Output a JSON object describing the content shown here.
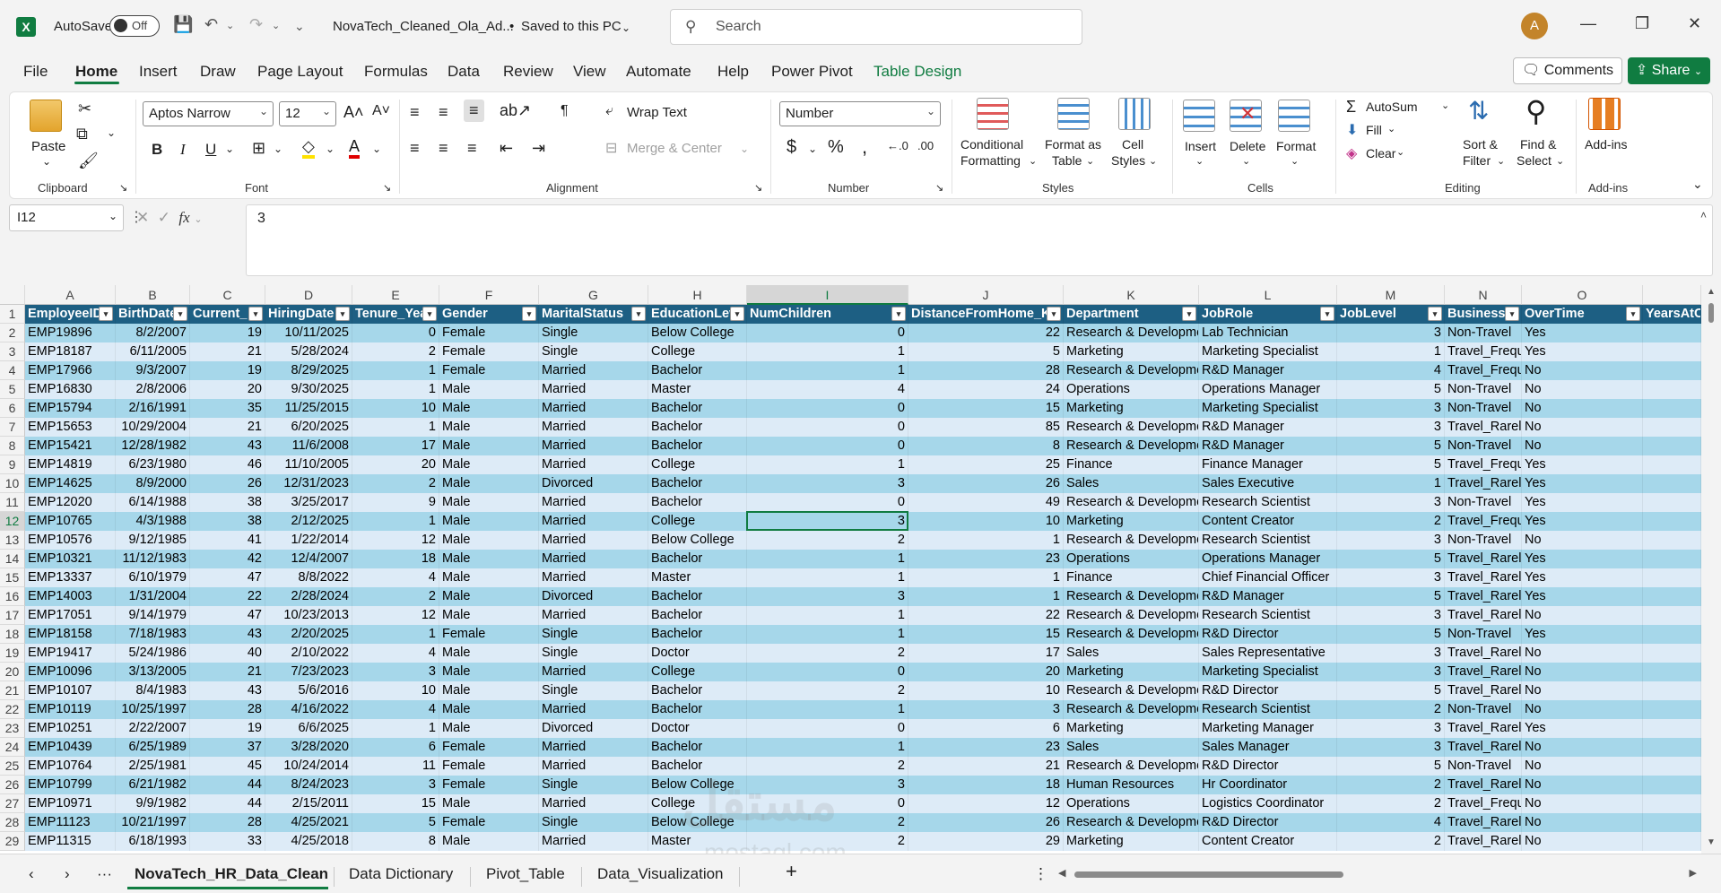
{
  "titlebar": {
    "autosave_label": "AutoSave",
    "autosave_state": "Off",
    "filename": "NovaTech_Cleaned_Ola_Ad...",
    "save_status": "Saved to this PC",
    "search_placeholder": "Search",
    "user_initial": "A"
  },
  "menu": {
    "file": "File",
    "home": "Home",
    "insert": "Insert",
    "draw": "Draw",
    "page_layout": "Page Layout",
    "formulas": "Formulas",
    "data": "Data",
    "review": "Review",
    "view": "View",
    "automate": "Automate",
    "help": "Help",
    "power_pivot": "Power Pivot",
    "table_design": "Table Design",
    "comments": "Comments",
    "share": "Share"
  },
  "ribbon": {
    "clipboard": {
      "paste": "Paste",
      "label": "Clipboard"
    },
    "font": {
      "name": "Aptos Narrow",
      "size": "12",
      "label": "Font"
    },
    "alignment": {
      "wrap": "Wrap Text",
      "merge": "Merge & Center",
      "label": "Alignment"
    },
    "number": {
      "format": "Number",
      "label": "Number"
    },
    "styles": {
      "conditional_1": "Conditional",
      "conditional_2": "Formatting",
      "format_table_1": "Format as",
      "format_table_2": "Table",
      "cell_styles_1": "Cell",
      "cell_styles_2": "Styles",
      "label": "Styles"
    },
    "cells": {
      "insert": "Insert",
      "delete": "Delete",
      "format": "Format",
      "label": "Cells"
    },
    "editing": {
      "autosum": "AutoSum",
      "fill": "Fill",
      "clear": "Clear",
      "sort_1": "Sort &",
      "sort_2": "Filter",
      "find_1": "Find &",
      "find_2": "Select",
      "label": "Editing"
    },
    "addins": {
      "addins": "Add-ins",
      "label": "Add-ins"
    }
  },
  "formula_bar": {
    "name_box": "I12",
    "formula": "3"
  },
  "columns": [
    "A",
    "B",
    "C",
    "D",
    "E",
    "F",
    "G",
    "H",
    "I",
    "J",
    "K",
    "L",
    "M",
    "N",
    "O"
  ],
  "headers": [
    "EmployeeID",
    "BirthDate",
    "Current_",
    "HiringDate",
    "Tenure_Yea",
    "Gender",
    "MaritalStatus",
    "EducationLev",
    "NumChildren",
    "DistanceFromHome_Kl",
    "Department",
    "JobRole",
    "JobLevel",
    "Business",
    "OverTime",
    "YearsAtC"
  ],
  "rows": [
    [
      "EMP19896",
      "8/2/2007",
      "19",
      "10/11/2025",
      "0",
      "Female",
      "Single",
      "Below College",
      "0",
      "22",
      "Research & Developme",
      "Lab Technician",
      "3",
      "Non-Travel",
      "Yes"
    ],
    [
      "EMP18187",
      "6/11/2005",
      "21",
      "5/28/2024",
      "2",
      "Female",
      "Single",
      "College",
      "1",
      "5",
      "Marketing",
      "Marketing Specialist",
      "1",
      "Travel_Frequ",
      "Yes"
    ],
    [
      "EMP17966",
      "9/3/2007",
      "19",
      "8/29/2025",
      "1",
      "Female",
      "Married",
      "Bachelor",
      "1",
      "28",
      "Research & Developme",
      "R&D Manager",
      "4",
      "Travel_Frequ",
      "No"
    ],
    [
      "EMP16830",
      "2/8/2006",
      "20",
      "9/30/2025",
      "1",
      "Male",
      "Married",
      "Master",
      "4",
      "24",
      "Operations",
      "Operations Manager",
      "5",
      "Non-Travel",
      "No"
    ],
    [
      "EMP15794",
      "2/16/1991",
      "35",
      "11/25/2015",
      "10",
      "Male",
      "Married",
      "Bachelor",
      "0",
      "15",
      "Marketing",
      "Marketing Specialist",
      "3",
      "Non-Travel",
      "No"
    ],
    [
      "EMP15653",
      "10/29/2004",
      "21",
      "6/20/2025",
      "1",
      "Male",
      "Married",
      "Bachelor",
      "0",
      "85",
      "Research & Developme",
      "R&D Manager",
      "3",
      "Travel_Rarel",
      "No"
    ],
    [
      "EMP15421",
      "12/28/1982",
      "43",
      "11/6/2008",
      "17",
      "Male",
      "Married",
      "Bachelor",
      "0",
      "8",
      "Research & Developme",
      "R&D Manager",
      "5",
      "Non-Travel",
      "No"
    ],
    [
      "EMP14819",
      "6/23/1980",
      "46",
      "11/10/2005",
      "20",
      "Male",
      "Married",
      "College",
      "1",
      "25",
      "Finance",
      "Finance Manager",
      "5",
      "Travel_Frequ",
      "Yes"
    ],
    [
      "EMP14625",
      "8/9/2000",
      "26",
      "12/31/2023",
      "2",
      "Male",
      "Divorced",
      "Bachelor",
      "3",
      "26",
      "Sales",
      "Sales Executive",
      "1",
      "Travel_Rarel",
      "Yes"
    ],
    [
      "EMP12020",
      "6/14/1988",
      "38",
      "3/25/2017",
      "9",
      "Male",
      "Married",
      "Bachelor",
      "0",
      "49",
      "Research & Developme",
      "Research Scientist",
      "3",
      "Non-Travel",
      "Yes"
    ],
    [
      "EMP10765",
      "4/3/1988",
      "38",
      "2/12/2025",
      "1",
      "Male",
      "Married",
      "College",
      "3",
      "10",
      "Marketing",
      "Content Creator",
      "2",
      "Travel_Frequ",
      "Yes"
    ],
    [
      "EMP10576",
      "9/12/1985",
      "41",
      "1/22/2014",
      "12",
      "Male",
      "Married",
      "Below College",
      "2",
      "1",
      "Research & Developme",
      "Research Scientist",
      "3",
      "Non-Travel",
      "No"
    ],
    [
      "EMP10321",
      "11/12/1983",
      "42",
      "12/4/2007",
      "18",
      "Male",
      "Married",
      "Bachelor",
      "1",
      "23",
      "Operations",
      "Operations Manager",
      "5",
      "Travel_Rarel",
      "Yes"
    ],
    [
      "EMP13337",
      "6/10/1979",
      "47",
      "8/8/2022",
      "4",
      "Male",
      "Married",
      "Master",
      "1",
      "1",
      "Finance",
      "Chief Financial Officer",
      "3",
      "Travel_Rarel",
      "Yes"
    ],
    [
      "EMP14003",
      "1/31/2004",
      "22",
      "2/28/2024",
      "2",
      "Male",
      "Divorced",
      "Bachelor",
      "3",
      "1",
      "Research & Developme",
      "R&D Manager",
      "5",
      "Travel_Rarel",
      "Yes"
    ],
    [
      "EMP17051",
      "9/14/1979",
      "47",
      "10/23/2013",
      "12",
      "Male",
      "Married",
      "Bachelor",
      "1",
      "22",
      "Research & Developme",
      "Research Scientist",
      "3",
      "Travel_Rarel",
      "No"
    ],
    [
      "EMP18158",
      "7/18/1983",
      "43",
      "2/20/2025",
      "1",
      "Female",
      "Single",
      "Bachelor",
      "1",
      "15",
      "Research & Developme",
      "R&D Director",
      "5",
      "Non-Travel",
      "Yes"
    ],
    [
      "EMP19417",
      "5/24/1986",
      "40",
      "2/10/2022",
      "4",
      "Male",
      "Single",
      "Doctor",
      "2",
      "17",
      "Sales",
      "Sales Representative",
      "3",
      "Travel_Rarel",
      "No"
    ],
    [
      "EMP10096",
      "3/13/2005",
      "21",
      "7/23/2023",
      "3",
      "Male",
      "Married",
      "College",
      "0",
      "20",
      "Marketing",
      "Marketing Specialist",
      "3",
      "Travel_Rarel",
      "No"
    ],
    [
      "EMP10107",
      "8/4/1983",
      "43",
      "5/6/2016",
      "10",
      "Male",
      "Single",
      "Bachelor",
      "2",
      "10",
      "Research & Developme",
      "R&D Director",
      "5",
      "Travel_Rarel",
      "No"
    ],
    [
      "EMP10119",
      "10/25/1997",
      "28",
      "4/16/2022",
      "4",
      "Male",
      "Married",
      "Bachelor",
      "1",
      "3",
      "Research & Developme",
      "Research Scientist",
      "2",
      "Non-Travel",
      "No"
    ],
    [
      "EMP10251",
      "2/22/2007",
      "19",
      "6/6/2025",
      "1",
      "Male",
      "Divorced",
      "Doctor",
      "0",
      "6",
      "Marketing",
      "Marketing Manager",
      "3",
      "Travel_Rarel",
      "Yes"
    ],
    [
      "EMP10439",
      "6/25/1989",
      "37",
      "3/28/2020",
      "6",
      "Female",
      "Married",
      "Bachelor",
      "1",
      "23",
      "Sales",
      "Sales Manager",
      "3",
      "Travel_Rarel",
      "No"
    ],
    [
      "EMP10764",
      "2/25/1981",
      "45",
      "10/24/2014",
      "11",
      "Female",
      "Married",
      "Bachelor",
      "2",
      "21",
      "Research & Developme",
      "R&D Director",
      "5",
      "Non-Travel",
      "No"
    ],
    [
      "EMP10799",
      "6/21/1982",
      "44",
      "8/24/2023",
      "3",
      "Female",
      "Single",
      "Below College",
      "3",
      "18",
      "Human Resources",
      "Hr Coordinator",
      "2",
      "Travel_Rarel",
      "No"
    ],
    [
      "EMP10971",
      "9/9/1982",
      "44",
      "2/15/2011",
      "15",
      "Male",
      "Married",
      "College",
      "0",
      "12",
      "Operations",
      "Logistics Coordinator",
      "2",
      "Travel_Frequ",
      "No"
    ],
    [
      "EMP11123",
      "10/21/1997",
      "28",
      "4/25/2021",
      "5",
      "Female",
      "Single",
      "Below College",
      "2",
      "26",
      "Research & Developme",
      "R&D Director",
      "4",
      "Travel_Rarel",
      "No"
    ],
    [
      "EMP11315",
      "6/18/1993",
      "33",
      "4/25/2018",
      "8",
      "Male",
      "Married",
      "Master",
      "2",
      "29",
      "Marketing",
      "Content Creator",
      "2",
      "Travel_Rarel",
      "No"
    ]
  ],
  "sheet_tabs": [
    "NovaTech_HR_Data_Clean",
    "Data Dictionary",
    "Pivot_Table",
    "Data_Visualization"
  ],
  "watermark": {
    "line1": "مستقل",
    "line2": "mostaql.com"
  },
  "colors": {
    "accent": "#107c41",
    "header_fill": "#1d5f83",
    "band_light": "#ddebf7",
    "band_blue": "#a6d7ea"
  }
}
